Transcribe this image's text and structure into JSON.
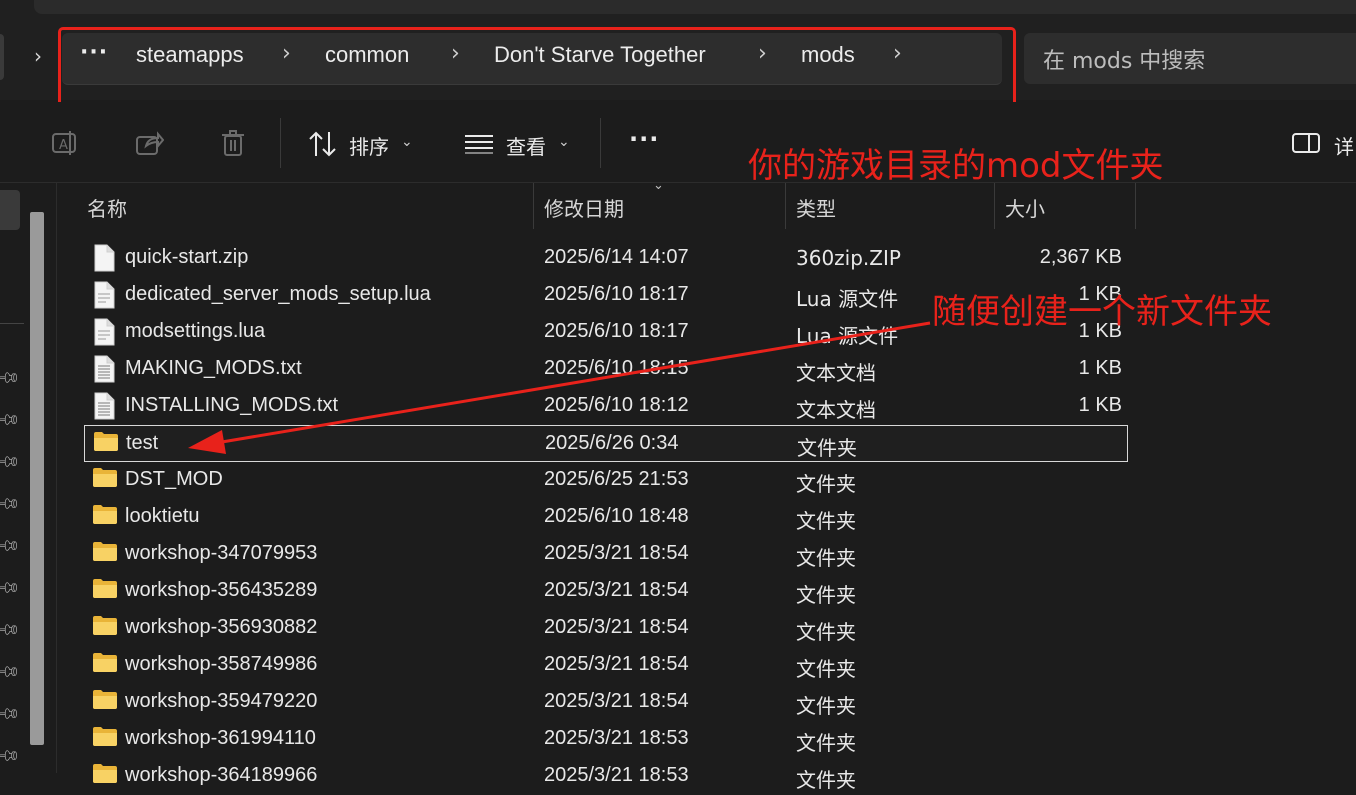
{
  "address": {
    "more": "···",
    "crumbs": [
      "steamapps",
      "common",
      "Don't Starve Together",
      "mods"
    ],
    "search_placeholder": "在 mods 中搜索"
  },
  "toolbar": {
    "sort_label": "排序",
    "view_label": "查看",
    "more": "···",
    "details_label": "详"
  },
  "annotations": {
    "title": "你的游戏目录的mod文件夹",
    "hint": "随便创建一个新文件夹",
    "color": "#e8221b"
  },
  "columns": {
    "name": "名称",
    "date": "修改日期",
    "type": "类型",
    "size": "大小"
  },
  "files": [
    {
      "name": "quick-start.zip",
      "date": "2025/6/14 14:07",
      "type": "360zip.ZIP",
      "size": "2,367 KB",
      "icon": "zip-file-icon"
    },
    {
      "name": "dedicated_server_mods_setup.lua",
      "date": "2025/6/10 18:17",
      "type": "Lua 源文件",
      "size": "1 KB",
      "icon": "lua-file-icon"
    },
    {
      "name": "modsettings.lua",
      "date": "2025/6/10 18:17",
      "type": "Lua 源文件",
      "size": "1 KB",
      "icon": "lua-file-icon"
    },
    {
      "name": "MAKING_MODS.txt",
      "date": "2025/6/10 18:15",
      "type": "文本文档",
      "size": "1 KB",
      "icon": "text-file-icon"
    },
    {
      "name": "INSTALLING_MODS.txt",
      "date": "2025/6/10 18:12",
      "type": "文本文档",
      "size": "1 KB",
      "icon": "text-file-icon"
    },
    {
      "name": "test",
      "date": "2025/6/26 0:34",
      "type": "文件夹",
      "size": "",
      "icon": "folder-icon"
    },
    {
      "name": "DST_MOD",
      "date": "2025/6/25 21:53",
      "type": "文件夹",
      "size": "",
      "icon": "folder-icon"
    },
    {
      "name": "looktietu",
      "date": "2025/6/10 18:48",
      "type": "文件夹",
      "size": "",
      "icon": "folder-icon"
    },
    {
      "name": "workshop-347079953",
      "date": "2025/3/21 18:54",
      "type": "文件夹",
      "size": "",
      "icon": "folder-icon"
    },
    {
      "name": "workshop-356435289",
      "date": "2025/3/21 18:54",
      "type": "文件夹",
      "size": "",
      "icon": "folder-icon"
    },
    {
      "name": "workshop-356930882",
      "date": "2025/3/21 18:54",
      "type": "文件夹",
      "size": "",
      "icon": "folder-icon"
    },
    {
      "name": "workshop-358749986",
      "date": "2025/3/21 18:54",
      "type": "文件夹",
      "size": "",
      "icon": "folder-icon"
    },
    {
      "name": "workshop-359479220",
      "date": "2025/3/21 18:54",
      "type": "文件夹",
      "size": "",
      "icon": "folder-icon"
    },
    {
      "name": "workshop-361994110",
      "date": "2025/3/21 18:53",
      "type": "文件夹",
      "size": "",
      "icon": "folder-icon"
    },
    {
      "name": "workshop-364189966",
      "date": "2025/3/21 18:53",
      "type": "文件夹",
      "size": "",
      "icon": "folder-icon"
    }
  ],
  "selected_file": "test"
}
